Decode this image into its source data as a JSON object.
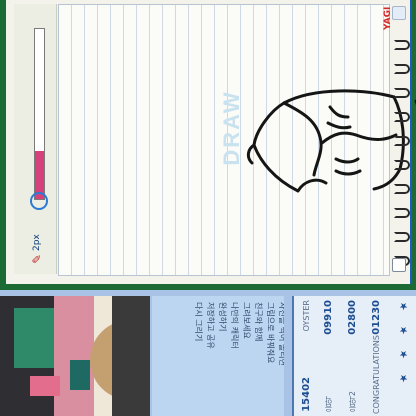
{
  "brush": {
    "fill_percent": 28
  },
  "canvas": {
    "watermark": "DRAW"
  },
  "tool": {
    "label": "2px"
  },
  "logo": {
    "text": "YAGI"
  },
  "notes": {
    "lines": [
      "사진을 찍어 올리면",
      "그림으로 바꿔줘요",
      "친구와 함께",
      "그려보세요",
      "나만의 캐릭터",
      "완성하기",
      "저장하고 공유",
      "다시 그리기"
    ]
  },
  "scores": {
    "rows": [
      {
        "label": "OYSTER",
        "value": "15402"
      },
      {
        "label": "음악",
        "value": "09910"
      },
      {
        "label": "음악2",
        "value": "02800"
      },
      {
        "label": "CONGRATULATIONS",
        "value": "01230"
      }
    ],
    "stars": 4
  },
  "colors": {
    "accent": "#1c6a34",
    "meter": "#d6417c",
    "star": "#ef7d18"
  }
}
